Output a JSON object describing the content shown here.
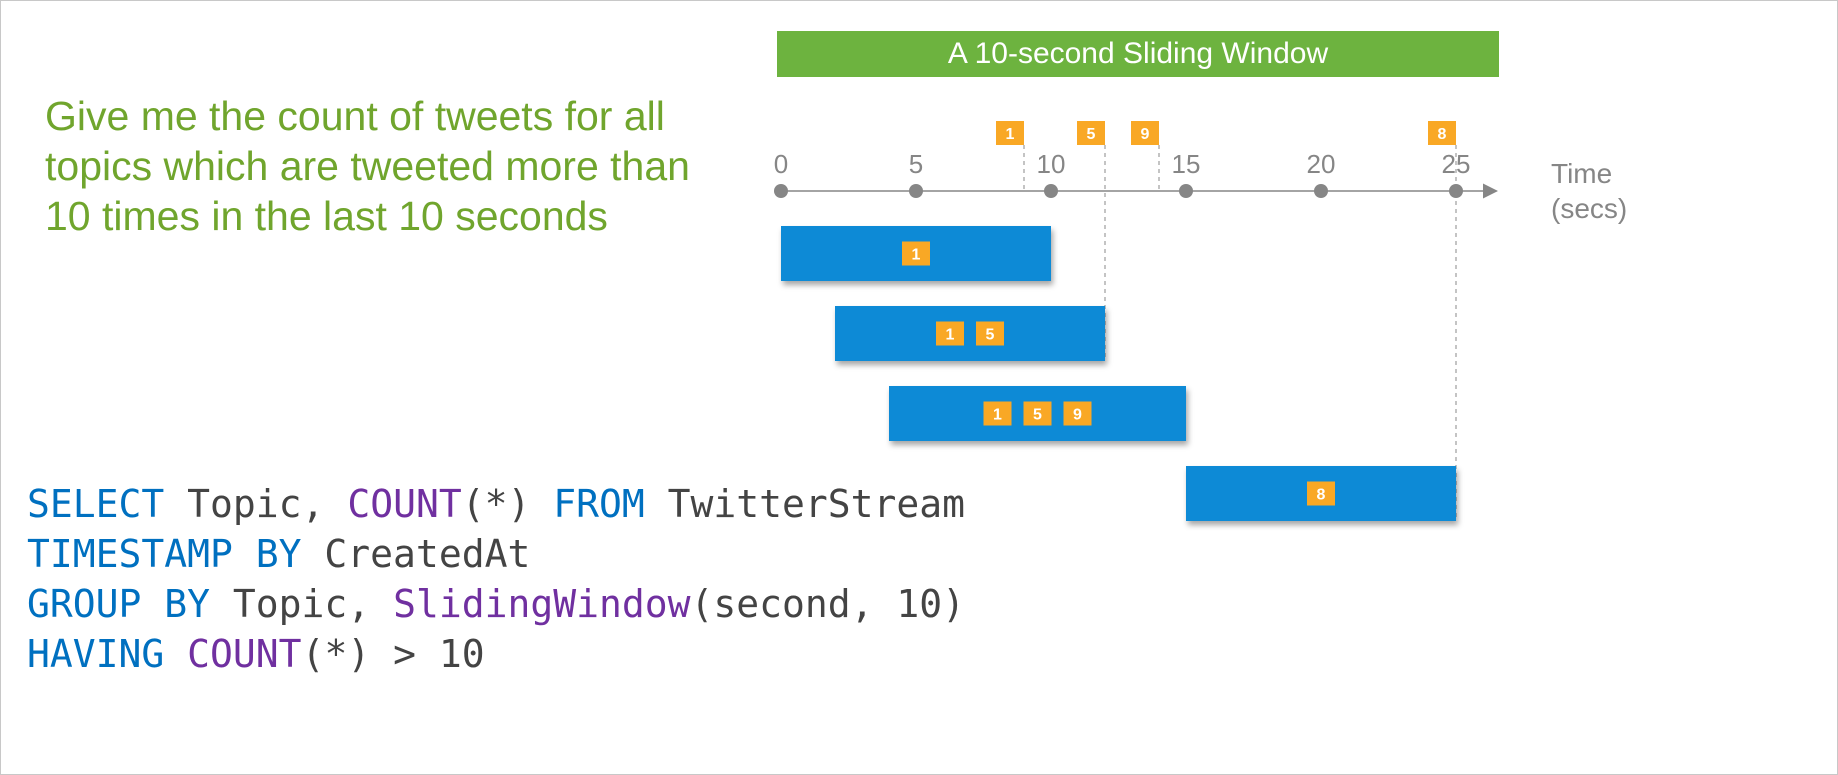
{
  "title": "A 10-second Sliding Window",
  "prompt": "Give me the count of tweets for all topics which are tweeted more than 10 times in the last 10 seconds",
  "axis_label_1": "Time",
  "axis_label_2": "(secs)",
  "sql": {
    "select": "SELECT",
    "topic1": " Topic, ",
    "count": "COUNT",
    "star": "(*) ",
    "from": "FROM",
    "stream": " TwitterStream",
    "ts": "TIMESTAMP BY",
    "created": " CreatedAt",
    "group": "GROUP BY",
    "topic2": " Topic, ",
    "sliding": "SlidingWindow",
    "args": "(second, 10)",
    "having": "HAVING",
    "count2": " COUNT",
    "tail": "(*) > 10"
  },
  "chart_data": {
    "type": "diagram",
    "timeline": {
      "ticks": [
        0,
        5,
        10,
        15,
        20,
        25
      ]
    },
    "events": [
      {
        "time": 9,
        "label": "1"
      },
      {
        "time": 12,
        "label": "5"
      },
      {
        "time": 14,
        "label": "9"
      },
      {
        "time": 25,
        "label": "8"
      }
    ],
    "windows": [
      {
        "start": 0,
        "end": 10,
        "contents": [
          "1"
        ]
      },
      {
        "start": 2,
        "end": 12,
        "contents": [
          "1",
          "5"
        ]
      },
      {
        "start": 4,
        "end": 15,
        "contents": [
          "1",
          "5",
          "9"
        ]
      },
      {
        "start": 15,
        "end": 25,
        "contents": [
          "8"
        ]
      }
    ]
  }
}
